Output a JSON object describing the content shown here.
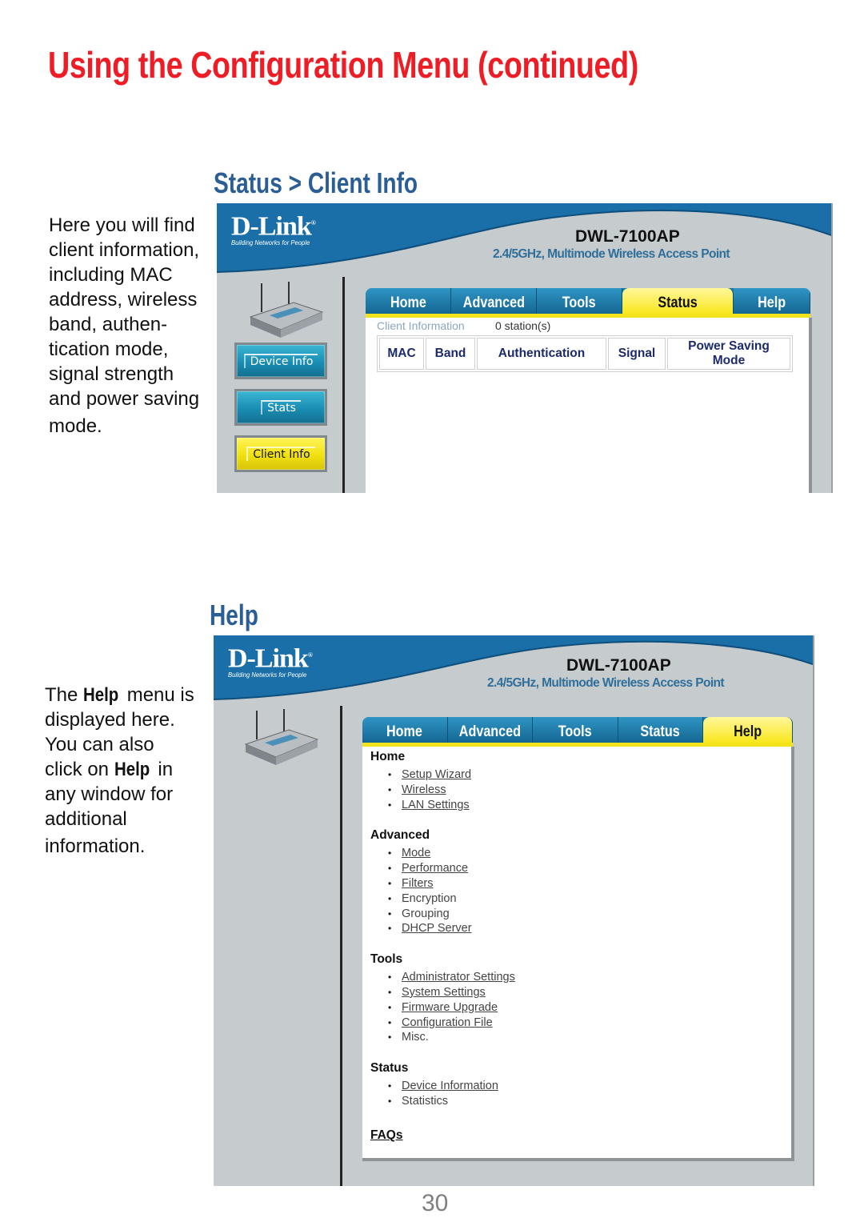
{
  "page": {
    "title": "Using the Configuration Menu (continued)",
    "page_number": "30",
    "colors": {
      "title": "#ee1c25",
      "section": "#2a5e95"
    }
  },
  "client_info_section": {
    "heading": "Status > Client Info",
    "description": [
      "Here you will find",
      "client information,",
      "including MAC",
      "address, wireless",
      "band, authen-",
      "tication mode,",
      "signal strength",
      "and power saving",
      "mode."
    ]
  },
  "help_section": {
    "heading": "Help",
    "description": {
      "line1_pre": "The ",
      "line1_bold": "Help",
      "line1_post": " menu is",
      "line2": "displayed here.",
      "line3": "You can also",
      "line4_pre": "click on ",
      "line4_bold": "Help",
      "line4_post": " in",
      "line5": "any window for",
      "line6": "additional",
      "line7": "information."
    }
  },
  "device_ui": {
    "brand": "D-Link",
    "brand_registered": "®",
    "tagline": "Building Networks for People",
    "model": "DWL-7100AP",
    "model_subtitle": "2.4/5GHz, Multimode Wireless Access Point",
    "tabs": [
      "Home",
      "Advanced",
      "Tools",
      "Status",
      "Help"
    ],
    "colors": {
      "banner": "#1a6fa8",
      "tab": "#1b7aa8",
      "tab_active": "#f7e615",
      "panel": "#c6cbcd"
    }
  },
  "client_info_screen": {
    "active_tab": "Status",
    "side_buttons": [
      "Device Info",
      "Stats",
      "Client Info"
    ],
    "active_side_button": "Client Info",
    "info_label": "Client Information",
    "station_count": "0 station(s)",
    "table_headers": [
      "MAC",
      "Band",
      "Authentication",
      "Signal",
      "Power Saving Mode"
    ],
    "table_rows": []
  },
  "help_screen": {
    "active_tab": "Help",
    "groups": [
      {
        "heading": "Home",
        "items": [
          {
            "label": "Setup Wizard",
            "link": true
          },
          {
            "label": "Wireless",
            "link": true
          },
          {
            "label": "LAN Settings",
            "link": true
          }
        ]
      },
      {
        "heading": "Advanced",
        "items": [
          {
            "label": "Mode",
            "link": true
          },
          {
            "label": "Performance",
            "link": true
          },
          {
            "label": "Filters",
            "link": true
          },
          {
            "label": "Encryption",
            "link": false
          },
          {
            "label": "Grouping",
            "link": false
          },
          {
            "label": "DHCP Server",
            "link": true
          }
        ]
      },
      {
        "heading": "Tools",
        "items": [
          {
            "label": "Administrator Settings",
            "link": true
          },
          {
            "label": "System Settings",
            "link": true
          },
          {
            "label": "Firmware Upgrade",
            "link": true
          },
          {
            "label": "Configuration File",
            "link": true
          },
          {
            "label": "Misc.",
            "link": false
          }
        ]
      },
      {
        "heading": "Status",
        "items": [
          {
            "label": "Device Information",
            "link": true
          },
          {
            "label": "Statistics",
            "link": false
          }
        ]
      }
    ],
    "faq_label": "FAQs"
  }
}
